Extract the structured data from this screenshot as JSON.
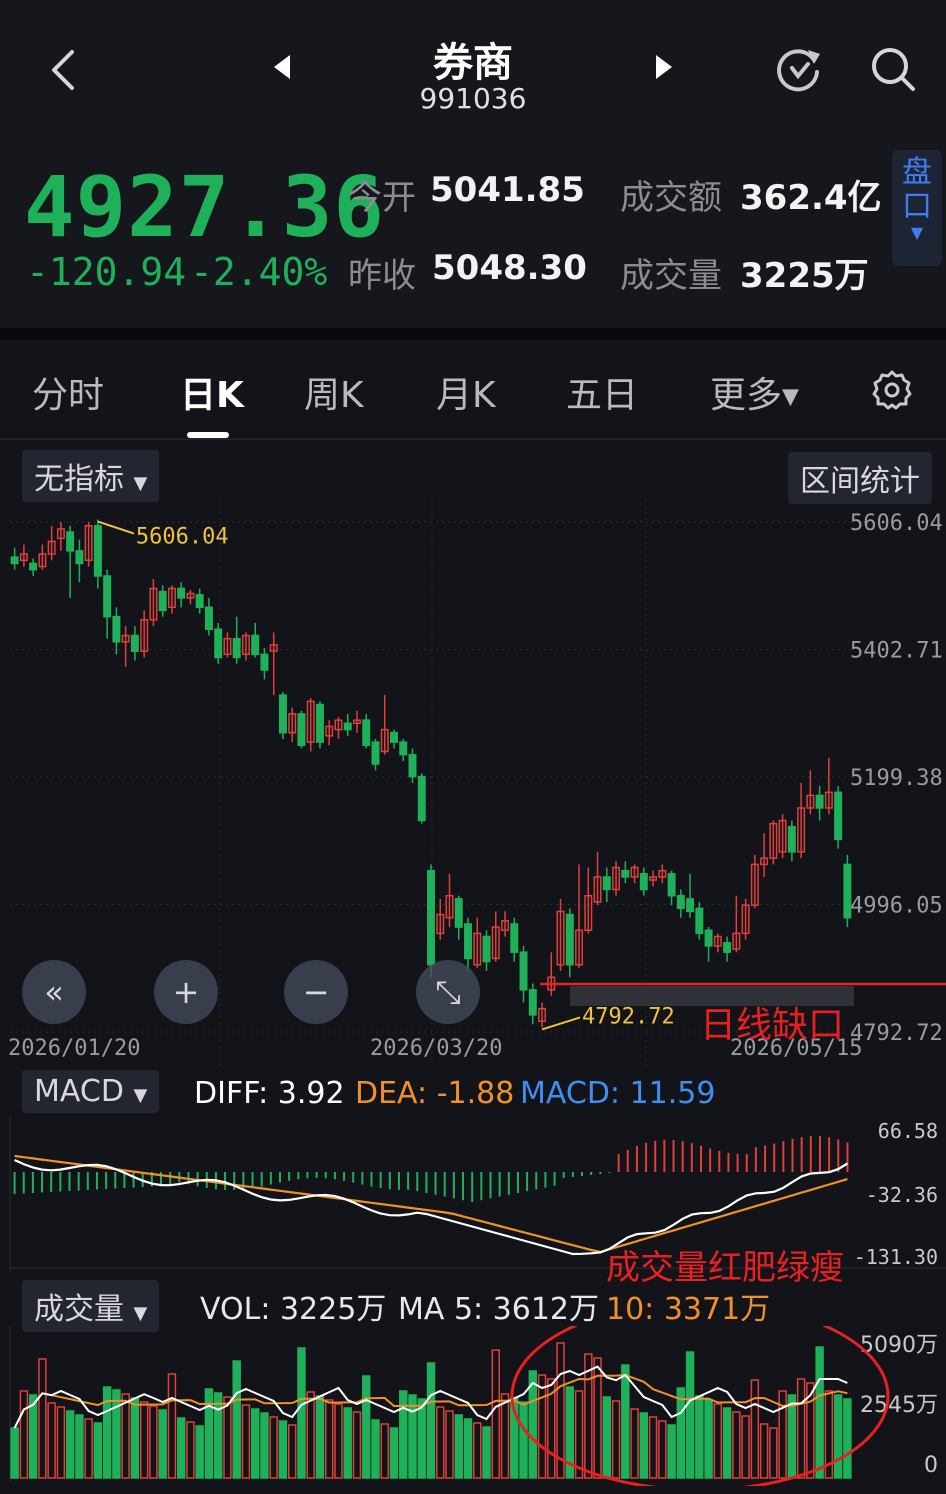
{
  "header": {
    "title": "券商",
    "code": "991036",
    "back_icon": "chevron-left-icon",
    "prev_icon": "triangle-left-icon",
    "next_icon": "triangle-right-icon",
    "refresh_icon": "refresh-icon",
    "search_icon": "search-icon"
  },
  "quote": {
    "price": "4927.36",
    "change": "-120.94",
    "change_pct": "-2.40%",
    "open_label": "今开",
    "open": "5041.85",
    "prev_close_label": "昨收",
    "prev_close": "5048.30",
    "amount_label": "成交额",
    "amount": "362.4亿",
    "volume_label": "成交量",
    "volume": "3225万",
    "pankou_label": "盘口"
  },
  "tabs": [
    {
      "label": "分时"
    },
    {
      "label": "日K"
    },
    {
      "label": "周K"
    },
    {
      "label": "月K"
    },
    {
      "label": "五日"
    },
    {
      "label": "更多"
    }
  ],
  "settings_icon": "gear-icon",
  "toolbar": {
    "indicator": "无指标",
    "range_stats": "区间统计"
  },
  "kline": {
    "y_ticks": [
      "5606.04",
      "5402.71",
      "5199.38",
      "4996.05",
      "4792.72"
    ],
    "x_ticks": [
      "2026/01/20",
      "2026/03/20",
      "2026/05/15"
    ],
    "high_label": "5606.04",
    "low_label": "4792.72",
    "annotation": "日线缺口",
    "controls": [
      "«",
      "+",
      "−",
      "⤡"
    ]
  },
  "macd": {
    "selector": "MACD",
    "diff": "DIFF: 3.92",
    "dea": "DEA: -1.88",
    "macd": "MACD: 11.59",
    "y_ticks": [
      "66.58",
      "-32.36",
      "-131.30"
    ]
  },
  "volume_panel": {
    "selector": "成交量",
    "vol": "VOL: 3225万",
    "ma5": "MA 5: 3612万",
    "ma10": "10: 3371万",
    "annotation": "成交量红肥绿瘦",
    "y_ticks": [
      "5090万",
      "2545万",
      "0"
    ]
  },
  "colors": {
    "up": "#e0403a",
    "down": "#1fb05a",
    "diff": "#ffffff",
    "dea": "#f0902a",
    "macd_label": "#3f8ff0",
    "high_low": "#f0c040",
    "annot": "#e82020"
  },
  "chart_data": {
    "type": "candlestick",
    "ylim": [
      4792.72,
      5606.04
    ],
    "candles": [
      [
        5550,
        5540,
        5530,
        5565
      ],
      [
        5545,
        5555,
        5535,
        5570
      ],
      [
        5540,
        5530,
        5520,
        5548
      ],
      [
        5535,
        5555,
        5530,
        5570
      ],
      [
        5555,
        5575,
        5545,
        5600
      ],
      [
        5580,
        5595,
        5560,
        5606
      ],
      [
        5590,
        5560,
        5485,
        5600
      ],
      [
        5560,
        5540,
        5510,
        5578
      ],
      [
        5545,
        5600,
        5535,
        5606
      ],
      [
        5600,
        5520,
        5500,
        5610
      ],
      [
        5520,
        5455,
        5420,
        5530
      ],
      [
        5455,
        5415,
        5395,
        5470
      ],
      [
        5415,
        5425,
        5375,
        5440
      ],
      [
        5425,
        5400,
        5385,
        5440
      ],
      [
        5400,
        5450,
        5390,
        5465
      ],
      [
        5450,
        5500,
        5440,
        5515
      ],
      [
        5495,
        5465,
        5455,
        5505
      ],
      [
        5470,
        5500,
        5460,
        5505
      ],
      [
        5500,
        5485,
        5470,
        5510
      ],
      [
        5485,
        5492,
        5475,
        5498
      ],
      [
        5490,
        5470,
        5460,
        5500
      ],
      [
        5470,
        5435,
        5425,
        5485
      ],
      [
        5435,
        5390,
        5380,
        5445
      ],
      [
        5395,
        5420,
        5390,
        5430
      ],
      [
        5420,
        5390,
        5380,
        5455
      ],
      [
        5395,
        5425,
        5385,
        5430
      ],
      [
        5425,
        5395,
        5390,
        5445
      ],
      [
        5395,
        5370,
        5355,
        5405
      ],
      [
        5400,
        5410,
        5330,
        5430
      ],
      [
        5330,
        5270,
        5260,
        5335
      ],
      [
        5270,
        5300,
        5255,
        5310
      ],
      [
        5300,
        5250,
        5245,
        5305
      ],
      [
        5255,
        5320,
        5240,
        5325
      ],
      [
        5315,
        5255,
        5245,
        5320
      ],
      [
        5265,
        5280,
        5250,
        5290
      ],
      [
        5275,
        5290,
        5260,
        5295
      ],
      [
        5285,
        5275,
        5265,
        5300
      ],
      [
        5285,
        5290,
        5270,
        5305
      ],
      [
        5290,
        5250,
        5245,
        5300
      ],
      [
        5255,
        5220,
        5210,
        5260
      ],
      [
        5240,
        5275,
        5235,
        5330
      ],
      [
        5270,
        5255,
        5245,
        5275
      ],
      [
        5255,
        5235,
        5225,
        5260
      ],
      [
        5235,
        5200,
        5190,
        5245
      ],
      [
        5200,
        5130,
        5125,
        5205
      ],
      [
        5050,
        4900,
        4880,
        5060
      ],
      [
        4950,
        4980,
        4940,
        5005
      ],
      [
        4975,
        5010,
        4960,
        5045
      ],
      [
        5005,
        4960,
        4940,
        5010
      ],
      [
        4965,
        4910,
        4890,
        4975
      ],
      [
        4900,
        4950,
        4895,
        4975
      ],
      [
        4945,
        4905,
        4890,
        4955
      ],
      [
        4910,
        4960,
        4905,
        4985
      ],
      [
        4955,
        4970,
        4945,
        4985
      ],
      [
        4965,
        4920,
        4905,
        4975
      ],
      [
        4920,
        4860,
        4840,
        4930
      ],
      [
        4860,
        4820,
        4805,
        4870
      ],
      [
        4810,
        4830,
        4800,
        4840
      ],
      [
        4860,
        4880,
        4850,
        4920
      ],
      [
        4900,
        4985,
        4890,
        5005
      ],
      [
        4980,
        4900,
        4880,
        4990
      ],
      [
        4900,
        4955,
        4895,
        5060
      ],
      [
        4955,
        5010,
        4950,
        5055
      ],
      [
        5000,
        5040,
        4995,
        5080
      ],
      [
        5040,
        5020,
        5000,
        5055
      ],
      [
        5020,
        5055,
        5010,
        5065
      ],
      [
        5050,
        5040,
        5030,
        5065
      ],
      [
        5040,
        5055,
        5030,
        5060
      ],
      [
        5045,
        5020,
        5010,
        5055
      ],
      [
        5035,
        5040,
        5025,
        5050
      ],
      [
        5040,
        5050,
        5030,
        5060
      ],
      [
        5045,
        5010,
        4995,
        5050
      ],
      [
        5010,
        4990,
        4975,
        5020
      ],
      [
        5005,
        4985,
        4975,
        5045
      ],
      [
        4990,
        4950,
        4940,
        5000
      ],
      [
        4955,
        4930,
        4905,
        4960
      ],
      [
        4930,
        4945,
        4920,
        4950
      ],
      [
        4935,
        4920,
        4905,
        4945
      ],
      [
        4925,
        4950,
        4920,
        5010
      ],
      [
        4950,
        4995,
        4940,
        5005
      ],
      [
        4995,
        5060,
        4990,
        5075
      ],
      [
        5060,
        5070,
        5040,
        5110
      ],
      [
        5070,
        5125,
        5060,
        5130
      ],
      [
        5080,
        5130,
        5070,
        5140
      ],
      [
        5120,
        5080,
        5065,
        5130
      ],
      [
        5080,
        5150,
        5070,
        5190
      ],
      [
        5150,
        5170,
        5140,
        5210
      ],
      [
        5170,
        5150,
        5130,
        5185
      ],
      [
        5150,
        5175,
        5140,
        5230
      ],
      [
        5175,
        5100,
        5085,
        5185
      ],
      [
        5060,
        4975,
        4960,
        5075
      ]
    ]
  }
}
